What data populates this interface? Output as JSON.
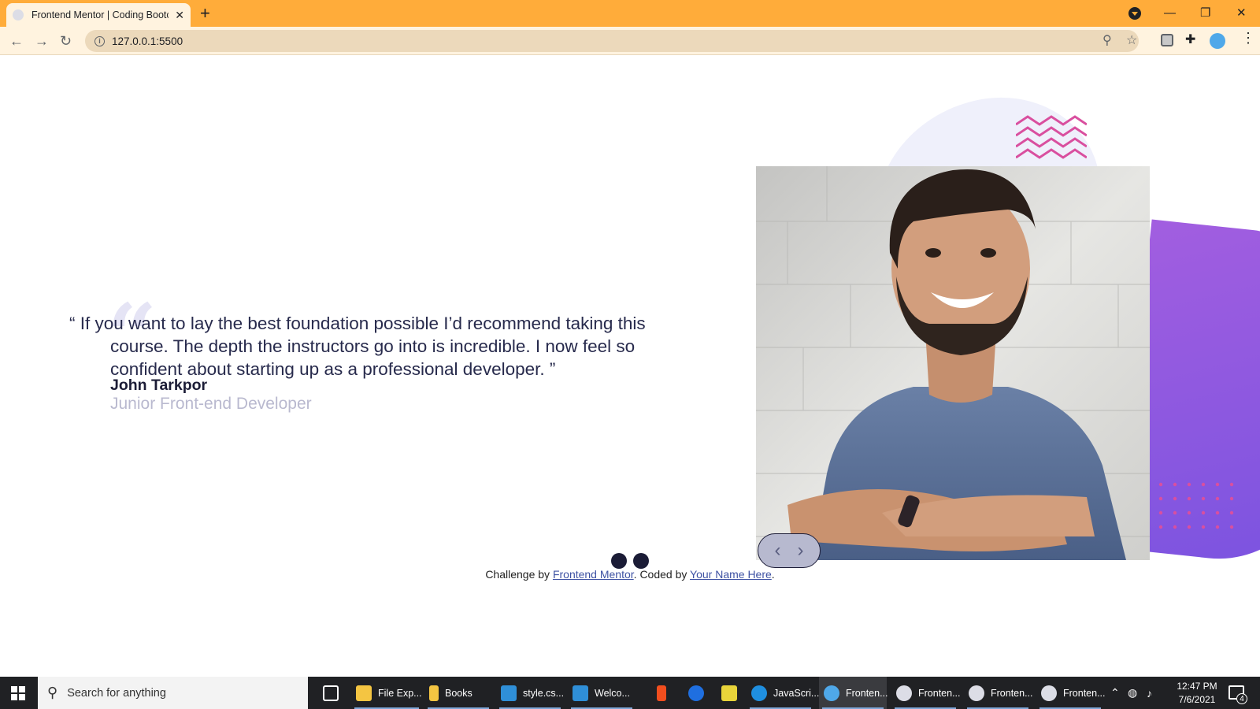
{
  "browser": {
    "tab_title": "Frontend Mentor | Coding Bootc",
    "tab_close": "✕",
    "new_tab": "+",
    "url": "127.0.0.1:5500",
    "icons": [
      "back-arrow-icon",
      "forward-arrow-icon",
      "reload-icon",
      "info-icon",
      "zoom-icon",
      "star-icon",
      "extension-icon",
      "puzzle-icon",
      "profile-icon",
      "kebab-menu-icon"
    ],
    "window_controls": {
      "minimize": "—",
      "restore": "❐",
      "close": "✕"
    }
  },
  "testimonial": {
    "quote": "“ If you want to lay the best foundation possible I’d recommend taking this course. The depth the instructors go into is incredible. I now feel so confident about starting up as a professional developer. ”",
    "author": "John Tarkpor",
    "role": "Junior Front-end Developer",
    "prev_label": "‹",
    "next_label": "›"
  },
  "footer": {
    "prefix": "Challenge by ",
    "link1": "Frontend Mentor",
    "middle": ". Coded by ",
    "link2": "Your Name Here",
    "suffix": "."
  },
  "taskbar": {
    "search_placeholder": "Search for anything",
    "items": [
      {
        "label": "File Exp...",
        "color": "#f4c542"
      },
      {
        "label": "Books",
        "color": "#f4c542"
      },
      {
        "label": "style.cs...",
        "color": "#2f8fd8"
      },
      {
        "label": "Welco...",
        "color": "#2f8fd8"
      },
      {
        "label": "",
        "color": "#f24e1e"
      },
      {
        "label": "",
        "color": "#1f6fe0"
      },
      {
        "label": "",
        "color": "#e8d43a"
      },
      {
        "label": "JavaScri...",
        "color": "#1f8fe0"
      },
      {
        "label": "Fronten...",
        "color": "#4fa8e9"
      },
      {
        "label": "Fronten...",
        "color": "#dcdde6"
      },
      {
        "label": "Fronten...",
        "color": "#dcdde6"
      },
      {
        "label": "Fronten...",
        "color": "#dcdde6"
      }
    ],
    "time": "12:47 PM",
    "date": "7/6/2021",
    "notification_count": "4"
  }
}
